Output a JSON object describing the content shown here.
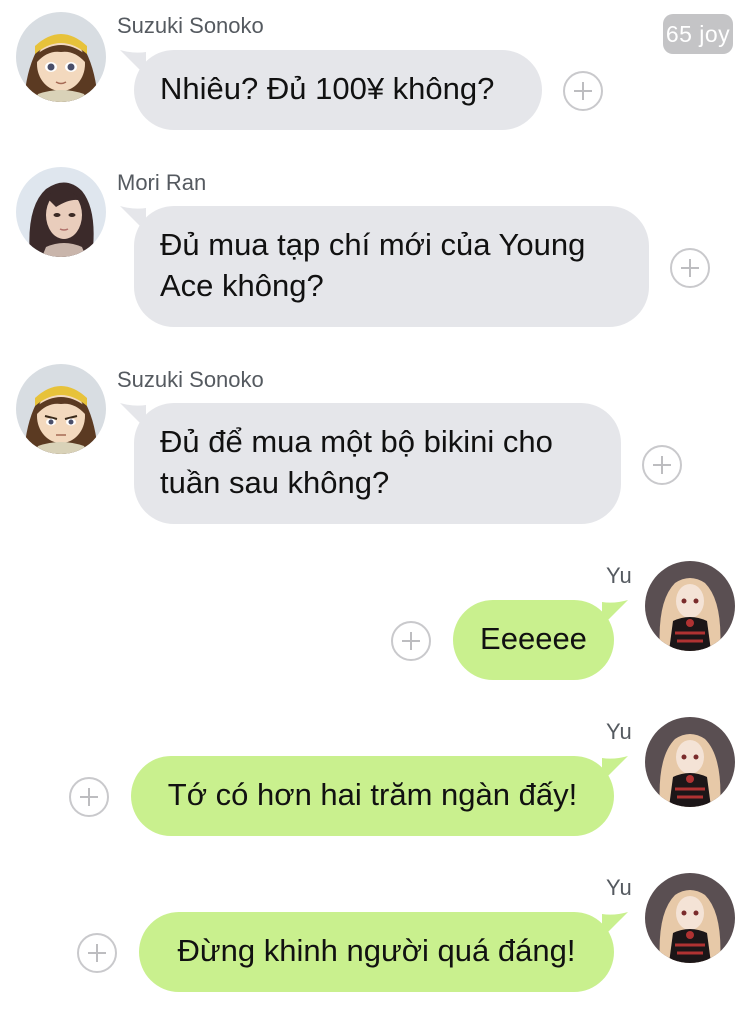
{
  "header": {
    "reaction_badge": "65 joy"
  },
  "messages": [
    {
      "sender": "Suzuki Sonoko",
      "direction": "incoming",
      "avatar": "anime-girl-headband-avatar",
      "text_lines": [
        "Nhiêu? Đủ 100¥ không?"
      ]
    },
    {
      "sender": "Mori Ran",
      "direction": "incoming",
      "avatar": "long-hair-girl-avatar",
      "text_lines": [
        "Đủ mua tạp chí mới của Young",
        "Ace không?"
      ]
    },
    {
      "sender": "Suzuki Sonoko",
      "direction": "incoming",
      "avatar": "anime-girl-headband-avatar",
      "text_lines": [
        "Đủ để mua một bộ bikini cho",
        "tuần sau không?"
      ]
    },
    {
      "sender": "Yu",
      "direction": "outgoing",
      "avatar": "gothic-doll-avatar",
      "text_lines": [
        "Eeeeee"
      ]
    },
    {
      "sender": "Yu",
      "direction": "outgoing",
      "avatar": "gothic-doll-avatar",
      "text_lines": [
        "Tớ có hơn hai trăm ngàn đấy!"
      ]
    },
    {
      "sender": "Yu",
      "direction": "outgoing",
      "avatar": "gothic-doll-avatar",
      "text_lines": [
        "Đừng khinh người quá đáng!"
      ]
    }
  ],
  "icons": {
    "reaction_add": "add-reaction-icon"
  },
  "colors": {
    "incoming_bubble": "#e5e6ea",
    "outgoing_bubble": "#c9f08e",
    "badge": "#c4c4c6"
  }
}
